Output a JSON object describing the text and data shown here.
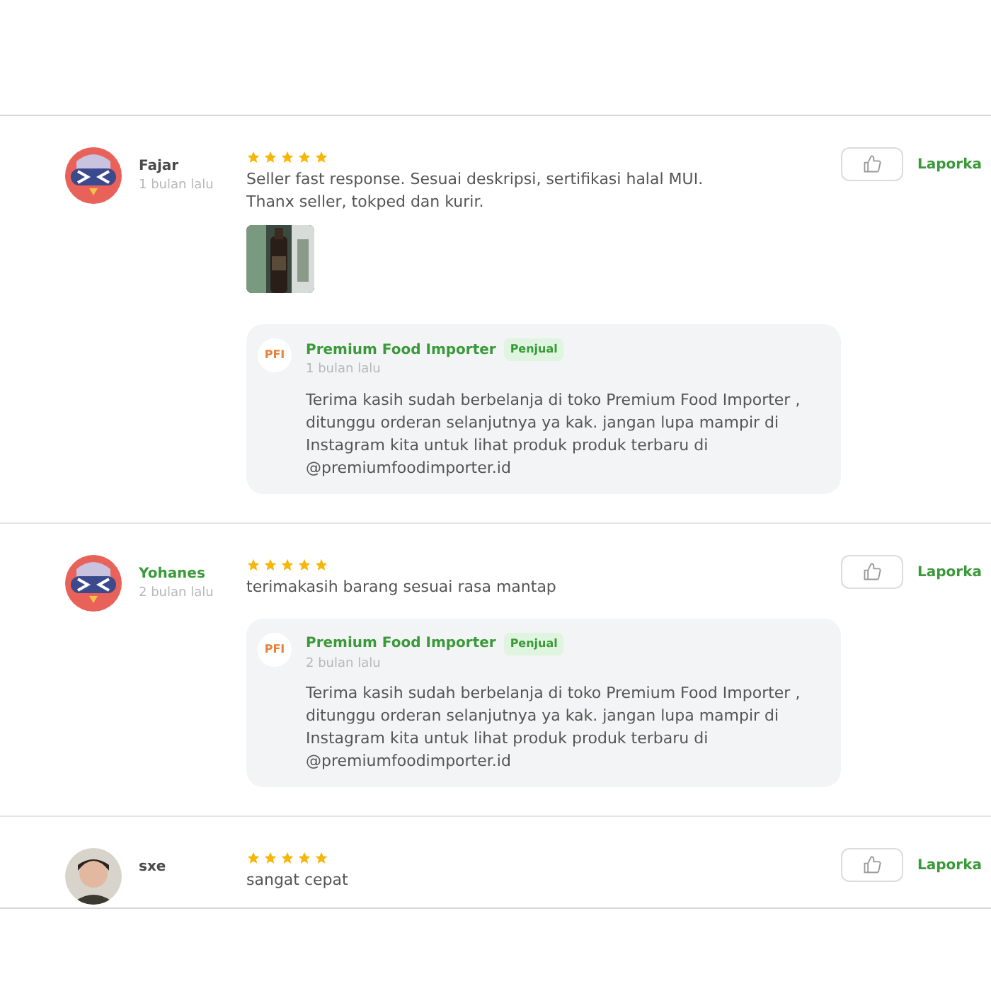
{
  "reviews": [
    {
      "name": "Fajar",
      "color": "#4a4a4a",
      "time": "1 bulan lalu",
      "avatar": {
        "kind": "illustration"
      },
      "stars": 5,
      "text": [
        "Seller fast response. Sesuai deskripsi, sertifikasi halal MUI.",
        "Thanx seller, tokped dan kurir."
      ],
      "photos": [
        {
          "kind": "picture"
        }
      ],
      "report": "Laporka",
      "reply": {
        "logo": "PFI",
        "seller": "Premium Food Importer",
        "badge": "Penjual",
        "time": "1 bulan lalu",
        "text": "Terima kasih sudah berbelanja di toko Premium Food Importer , ditunggu orderan selanjutnya ya kak. jangan lupa mampir di Instagram kita untuk lihat produk produk terbaru di @premiumfoodimporter.id"
      }
    },
    {
      "name": "Yohanes",
      "color": "#3a9a3a",
      "time": "2 bulan lalu",
      "avatar": {
        "kind": "illustration"
      },
      "stars": 5,
      "text": [
        "terimakasih barang sesuai rasa mantap"
      ],
      "report": "Laporka",
      "reply": {
        "logo": "PFI",
        "seller": "Premium Food Importer",
        "badge": "Penjual",
        "time": "2 bulan lalu",
        "text": "Terima kasih sudah berbelanja di toko Premium Food Importer , ditunggu orderan selanjutnya ya kak. jangan lupa mampir di Instagram kita untuk lihat produk produk terbaru di @premiumfoodimporter.id"
      }
    },
    {
      "name": "sxe",
      "color": "#4a4a4a",
      "avatar": {
        "kind": "picture"
      },
      "stars": 5,
      "text": [
        "sangat cepat"
      ],
      "report": "Laporka"
    }
  ]
}
